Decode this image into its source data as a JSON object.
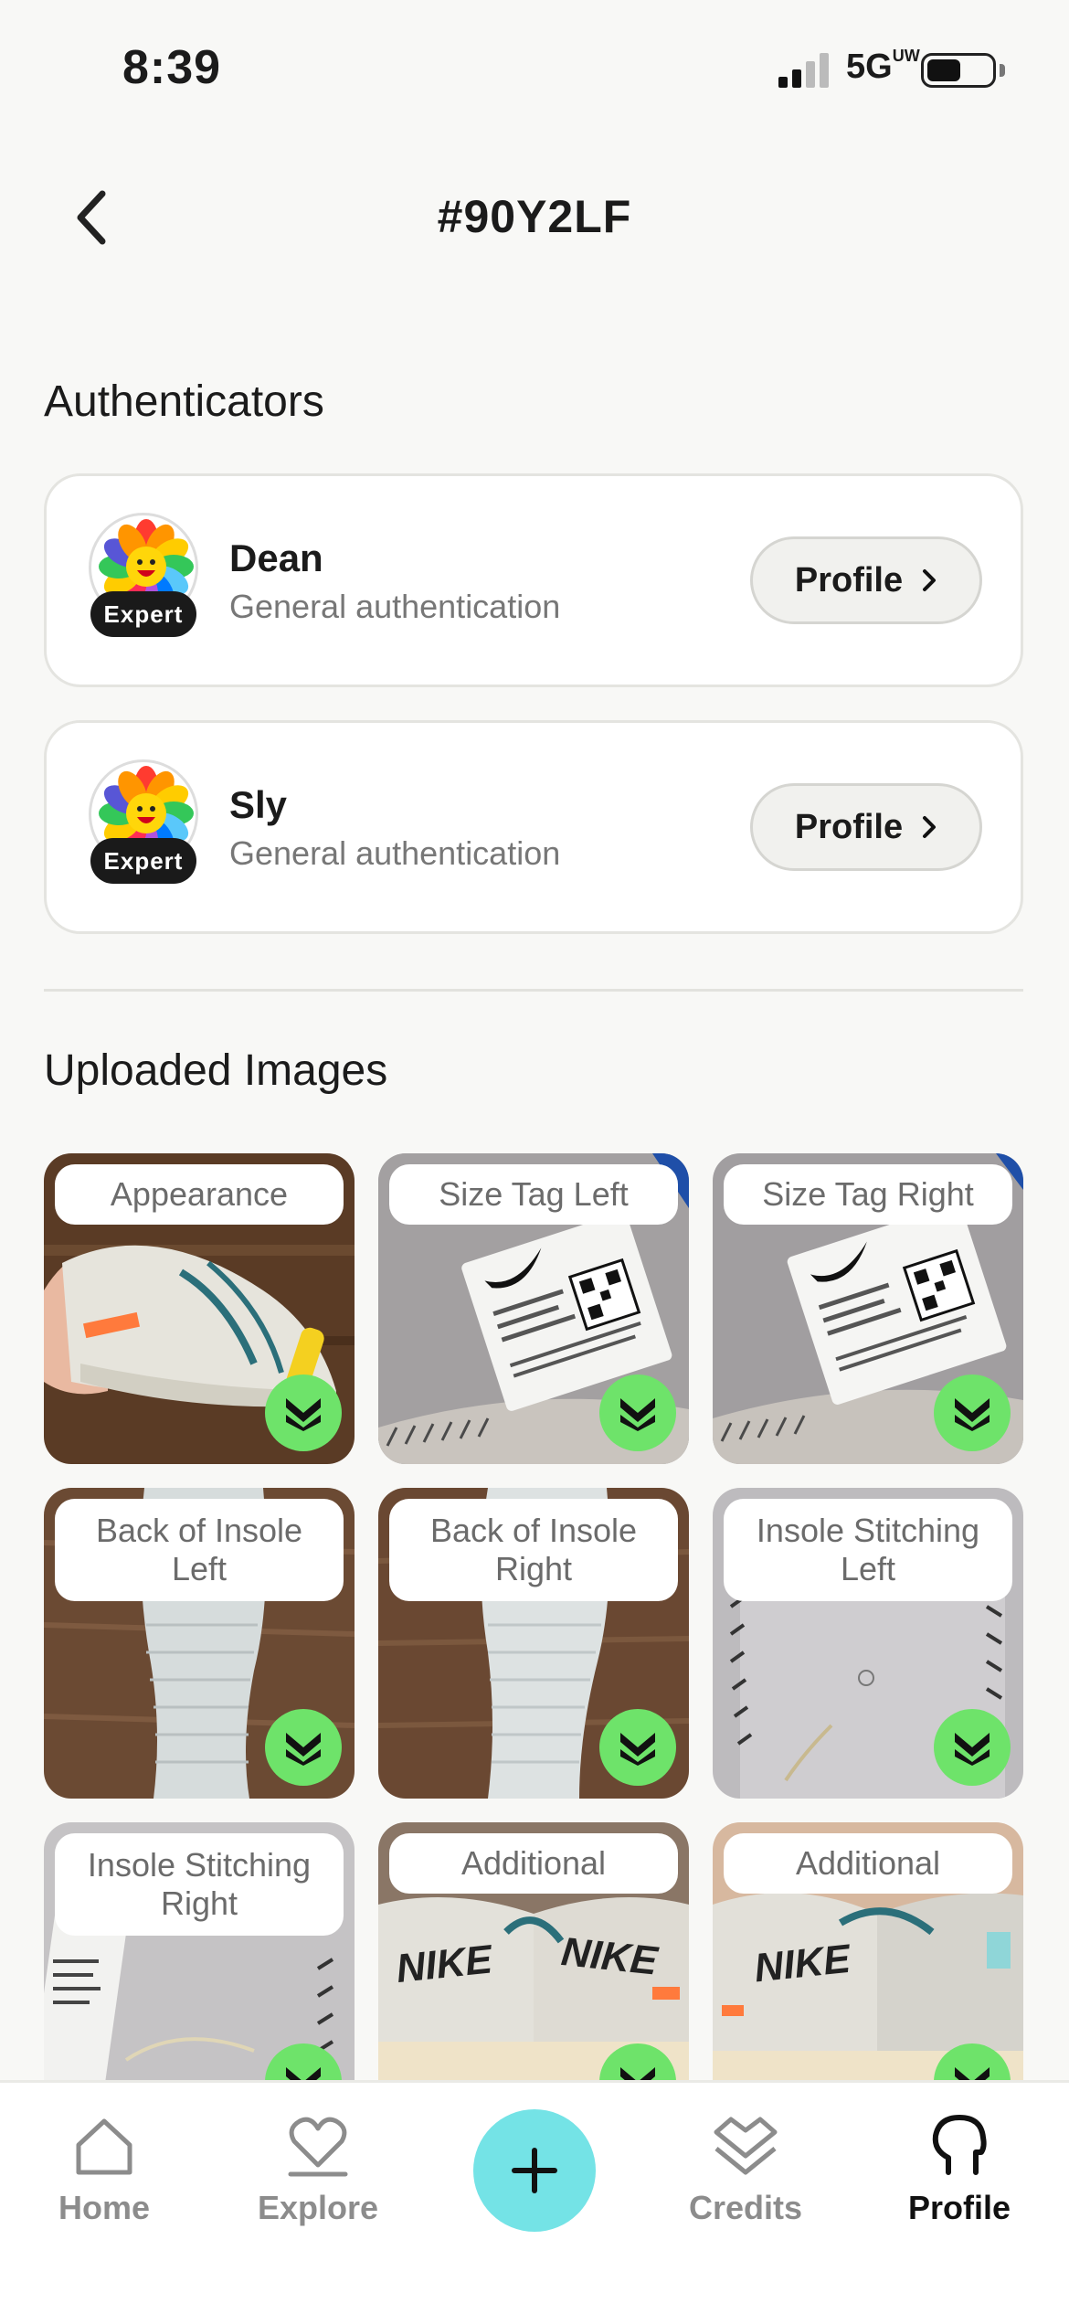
{
  "status_bar": {
    "time": "8:39",
    "network": "5G",
    "network_suffix": "UW"
  },
  "header": {
    "title": "#90Y2LF",
    "back_icon": "chevron-left-icon"
  },
  "authenticators": {
    "title": "Authenticators",
    "items": [
      {
        "name": "Dean",
        "role": "General authentication",
        "badge": "Expert",
        "button": "Profile"
      },
      {
        "name": "Sly",
        "role": "General authentication",
        "badge": "Expert",
        "button": "Profile"
      }
    ]
  },
  "uploaded_images": {
    "title": "Uploaded Images",
    "items": [
      {
        "label": "Appearance"
      },
      {
        "label": "Size Tag Left"
      },
      {
        "label": "Size Tag Right"
      },
      {
        "label": "Back of Insole Left"
      },
      {
        "label": "Back of Insole Right"
      },
      {
        "label": "Insole Stitching Left"
      },
      {
        "label": "Insole Stitching Right"
      },
      {
        "label": "Additional"
      },
      {
        "label": "Additional"
      }
    ]
  },
  "tabbar": {
    "home": "Home",
    "explore": "Explore",
    "credits": "Credits",
    "profile": "Profile",
    "active": "profile"
  },
  "colors": {
    "background": "#f8f8f6",
    "accent_fab": "#74e3e6",
    "verified_badge": "#6ee36a",
    "expert_badge": "#1a1a1a"
  }
}
